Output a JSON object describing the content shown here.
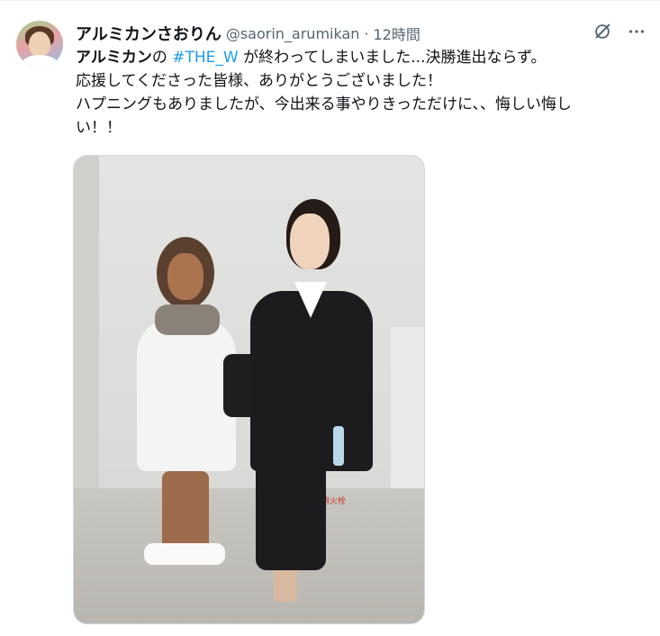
{
  "author": {
    "display_name": "アルミカンさおりん",
    "handle": "@saorin_arumikan",
    "separator": "·",
    "timestamp": "12時間"
  },
  "actions": {
    "grok_icon": "grok-icon",
    "more_icon": "more-icon"
  },
  "tweet": {
    "line1_bold": "アルミカン",
    "line1_mid": "の ",
    "hashtag": "#THE_W",
    "line1_rest": " が終わってしまいました...決勝進出ならず。",
    "line2": "応援してくださった皆様、ありがとうございました！",
    "line3": "ハプニングもありましたが、今出来る事やりきっただけに、、悔しい悔し",
    "line4": "い！！"
  },
  "media": {
    "sign_text": "消火栓"
  },
  "colors": {
    "link": "#1d9bf0",
    "secondary_text": "#536471",
    "primary_text": "#0f1419",
    "border": "#cfd9de"
  }
}
